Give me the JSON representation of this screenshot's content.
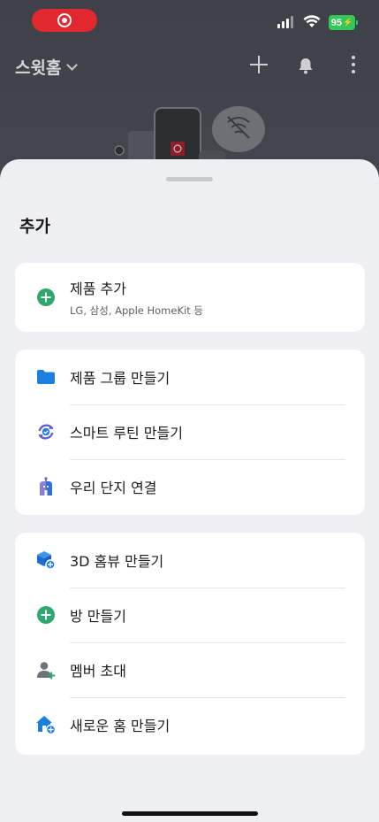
{
  "status_bar": {
    "battery": "95"
  },
  "header": {
    "home_name": "스윗홈",
    "icons": [
      "add-icon",
      "bell-icon",
      "more-icon",
      "chevron-down-icon"
    ]
  },
  "sheet": {
    "title": "추가",
    "sections": [
      {
        "items": [
          {
            "label": "제품 추가",
            "subtitle": "LG, 삼성, Apple HomeKit 등",
            "icon": "plus-circle-icon"
          }
        ]
      },
      {
        "items": [
          {
            "label": "제품 그룹 만들기",
            "icon": "folder-icon"
          },
          {
            "label": "스마트 루틴 만들기",
            "icon": "routine-icon"
          },
          {
            "label": "우리 단지 연결",
            "icon": "apartment-icon"
          }
        ]
      },
      {
        "items": [
          {
            "label": "3D 홈뷰 만들기",
            "icon": "3d-cube-icon"
          },
          {
            "label": "방 만들기",
            "icon": "plus-circle-icon"
          },
          {
            "label": "멤버 초대",
            "icon": "add-member-icon"
          },
          {
            "label": "새로운 홈 만들기",
            "icon": "new-home-icon"
          }
        ]
      }
    ]
  },
  "colors": {
    "accent_green": "#2fa86f",
    "accent_blue": "#1b7fe0",
    "accent_purple": "#6a5ccf",
    "record_red": "#e0282e",
    "battery_green": "#34c759"
  }
}
